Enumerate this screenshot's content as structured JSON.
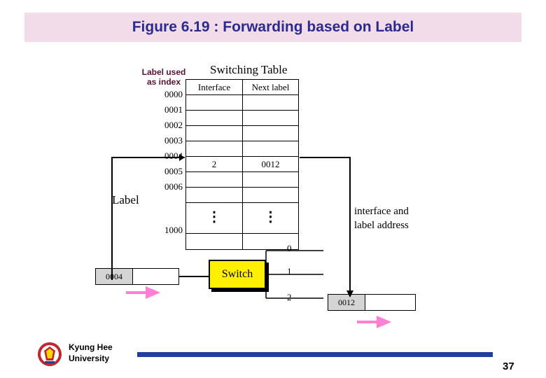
{
  "slide": {
    "title": "Figure 6.19 : Forwarding based on Label",
    "title_bg": "#f3dcea",
    "title_color": "#2b2b8f",
    "page_number": "37"
  },
  "footer": {
    "university_line1": "Kyung Hee",
    "university_line2": "University",
    "bar_color": "#1f3f9e"
  },
  "figure": {
    "switching_table_caption": "Switching Table",
    "label_used_as_index_line1": "Label used",
    "label_used_as_index_line2": "as index",
    "label_caption": "Label",
    "interface_and_label_address_line1": "interface and",
    "interface_and_label_address_line2": "label address",
    "switch_label": "Switch",
    "table": {
      "headers": [
        "Interface",
        "Next label"
      ],
      "index_labels": [
        "0000",
        "0001",
        "0002",
        "0003",
        "0004",
        "0005",
        "0006",
        "",
        "1000"
      ],
      "rows": [
        {
          "interface": "",
          "next_label": ""
        },
        {
          "interface": "",
          "next_label": ""
        },
        {
          "interface": "",
          "next_label": ""
        },
        {
          "interface": "",
          "next_label": ""
        },
        {
          "interface": "2",
          "next_label": "0012"
        },
        {
          "interface": "",
          "next_label": ""
        },
        {
          "interface": "",
          "next_label": ""
        },
        {
          "interface": "⋮",
          "next_label": "⋮"
        },
        {
          "interface": "",
          "next_label": ""
        }
      ]
    },
    "incoming_packet_label": "0004",
    "outgoing_packet_label": "0012",
    "ports": [
      "0",
      "1",
      "2"
    ],
    "arrow_color": "#ff7fd4",
    "switch_fill": "#ffef00"
  }
}
